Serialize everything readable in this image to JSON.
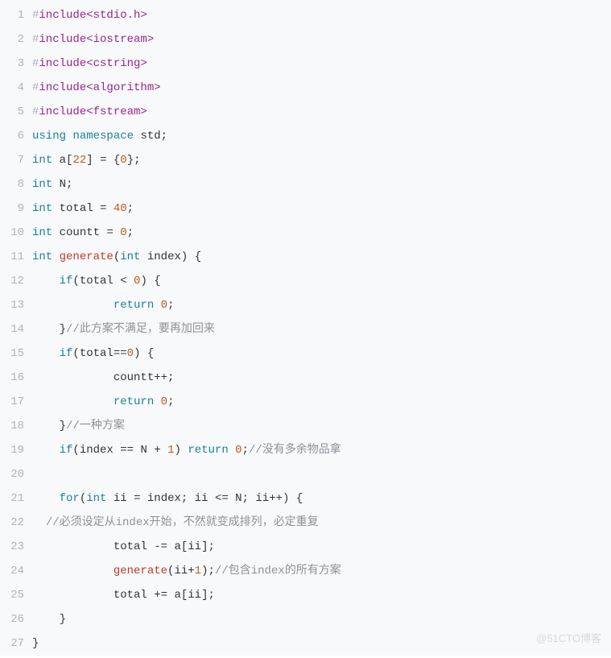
{
  "watermark": "@51CTO博客",
  "lines": [
    {
      "n": "1",
      "ind": 0,
      "tok": [
        [
          "pp",
          "#"
        ],
        [
          "kw",
          "include"
        ],
        [
          "hdr",
          "<stdio.h>"
        ]
      ]
    },
    {
      "n": "2",
      "ind": 0,
      "tok": [
        [
          "pp",
          "#"
        ],
        [
          "kw",
          "include"
        ],
        [
          "hdr",
          "<iostream>"
        ]
      ]
    },
    {
      "n": "3",
      "ind": 0,
      "tok": [
        [
          "pp",
          "#"
        ],
        [
          "kw",
          "include"
        ],
        [
          "hdr",
          "<cstring>"
        ]
      ]
    },
    {
      "n": "4",
      "ind": 0,
      "tok": [
        [
          "pp",
          "#"
        ],
        [
          "kw",
          "include"
        ],
        [
          "hdr",
          "<algorithm>"
        ]
      ]
    },
    {
      "n": "5",
      "ind": 0,
      "tok": [
        [
          "pp",
          "#"
        ],
        [
          "kw",
          "include"
        ],
        [
          "hdr",
          "<fstream>"
        ]
      ]
    },
    {
      "n": "6",
      "ind": 0,
      "tok": [
        [
          "kw2",
          "using"
        ],
        [
          "sp",
          " "
        ],
        [
          "kw2",
          "namespace"
        ],
        [
          "sp",
          " "
        ],
        [
          "id",
          "std"
        ],
        [
          "op",
          ";"
        ]
      ]
    },
    {
      "n": "7",
      "ind": 0,
      "tok": [
        [
          "kw2",
          "int"
        ],
        [
          "sp",
          " "
        ],
        [
          "id",
          "a"
        ],
        [
          "op",
          "["
        ],
        [
          "num",
          "22"
        ],
        [
          "op",
          "]"
        ],
        [
          "sp",
          " "
        ],
        [
          "op",
          "="
        ],
        [
          "sp",
          " "
        ],
        [
          "op",
          "{"
        ],
        [
          "num",
          "0"
        ],
        [
          "op",
          "};"
        ]
      ]
    },
    {
      "n": "8",
      "ind": 0,
      "tok": [
        [
          "kw2",
          "int"
        ],
        [
          "sp",
          " "
        ],
        [
          "id",
          "N"
        ],
        [
          "op",
          ";"
        ]
      ]
    },
    {
      "n": "9",
      "ind": 0,
      "tok": [
        [
          "kw2",
          "int"
        ],
        [
          "sp",
          " "
        ],
        [
          "id",
          "total"
        ],
        [
          "sp",
          " "
        ],
        [
          "op",
          "="
        ],
        [
          "sp",
          " "
        ],
        [
          "num",
          "40"
        ],
        [
          "op",
          ";"
        ]
      ]
    },
    {
      "n": "10",
      "ind": 0,
      "tok": [
        [
          "kw2",
          "int"
        ],
        [
          "sp",
          " "
        ],
        [
          "id",
          "countt"
        ],
        [
          "sp",
          " "
        ],
        [
          "op",
          "="
        ],
        [
          "sp",
          " "
        ],
        [
          "num",
          "0"
        ],
        [
          "op",
          ";"
        ]
      ]
    },
    {
      "n": "11",
      "ind": 0,
      "tok": [
        [
          "kw2",
          "int"
        ],
        [
          "sp",
          " "
        ],
        [
          "fn",
          "generate"
        ],
        [
          "op",
          "("
        ],
        [
          "kw2",
          "int"
        ],
        [
          "sp",
          " "
        ],
        [
          "id",
          "index"
        ],
        [
          "op",
          ")"
        ],
        [
          "sp",
          " "
        ],
        [
          "op",
          "{"
        ]
      ]
    },
    {
      "n": "12",
      "ind": 4,
      "tok": [
        [
          "kw2",
          "if"
        ],
        [
          "op",
          "("
        ],
        [
          "id",
          "total"
        ],
        [
          "sp",
          " "
        ],
        [
          "op",
          "<"
        ],
        [
          "sp",
          " "
        ],
        [
          "num",
          "0"
        ],
        [
          "op",
          ")"
        ],
        [
          "sp",
          " "
        ],
        [
          "op",
          "{"
        ]
      ]
    },
    {
      "n": "13",
      "ind": 12,
      "tok": [
        [
          "kw2",
          "return"
        ],
        [
          "sp",
          " "
        ],
        [
          "num",
          "0"
        ],
        [
          "op",
          ";"
        ]
      ]
    },
    {
      "n": "14",
      "ind": 4,
      "tok": [
        [
          "op",
          "}"
        ],
        [
          "cmt",
          "//此方案不满足，要再加回来"
        ]
      ]
    },
    {
      "n": "15",
      "ind": 4,
      "tok": [
        [
          "kw2",
          "if"
        ],
        [
          "op",
          "("
        ],
        [
          "id",
          "total"
        ],
        [
          "op",
          "=="
        ],
        [
          "num",
          "0"
        ],
        [
          "op",
          ")"
        ],
        [
          "sp",
          " "
        ],
        [
          "op",
          "{"
        ]
      ]
    },
    {
      "n": "16",
      "ind": 12,
      "tok": [
        [
          "id",
          "countt"
        ],
        [
          "op",
          "++;"
        ]
      ]
    },
    {
      "n": "17",
      "ind": 12,
      "tok": [
        [
          "kw2",
          "return"
        ],
        [
          "sp",
          " "
        ],
        [
          "num",
          "0"
        ],
        [
          "op",
          ";"
        ]
      ]
    },
    {
      "n": "18",
      "ind": 4,
      "tok": [
        [
          "op",
          "}"
        ],
        [
          "cmt",
          "//一种方案"
        ]
      ]
    },
    {
      "n": "19",
      "ind": 4,
      "tok": [
        [
          "kw2",
          "if"
        ],
        [
          "op",
          "("
        ],
        [
          "id",
          "index"
        ],
        [
          "sp",
          " "
        ],
        [
          "op",
          "=="
        ],
        [
          "sp",
          " "
        ],
        [
          "id",
          "N"
        ],
        [
          "sp",
          " "
        ],
        [
          "op",
          "+"
        ],
        [
          "sp",
          " "
        ],
        [
          "num",
          "1"
        ],
        [
          "op",
          ")"
        ],
        [
          "sp",
          " "
        ],
        [
          "kw2",
          "return"
        ],
        [
          "sp",
          " "
        ],
        [
          "num",
          "0"
        ],
        [
          "op",
          ";"
        ],
        [
          "cmt",
          "//没有多余物品拿"
        ]
      ]
    },
    {
      "n": "20",
      "ind": 0,
      "tok": []
    },
    {
      "n": "21",
      "ind": 4,
      "tok": [
        [
          "kw2",
          "for"
        ],
        [
          "op",
          "("
        ],
        [
          "kw2",
          "int"
        ],
        [
          "sp",
          " "
        ],
        [
          "id",
          "ii"
        ],
        [
          "sp",
          " "
        ],
        [
          "op",
          "="
        ],
        [
          "sp",
          " "
        ],
        [
          "id",
          "index"
        ],
        [
          "op",
          ";"
        ],
        [
          "sp",
          " "
        ],
        [
          "id",
          "ii"
        ],
        [
          "sp",
          " "
        ],
        [
          "op",
          "<="
        ],
        [
          "sp",
          " "
        ],
        [
          "id",
          "N"
        ],
        [
          "op",
          ";"
        ],
        [
          "sp",
          " "
        ],
        [
          "id",
          "ii"
        ],
        [
          "op",
          "++)"
        ],
        [
          "sp",
          " "
        ],
        [
          "op",
          "{"
        ]
      ]
    },
    {
      "n": "22",
      "ind": 2,
      "tok": [
        [
          "cmt",
          "//必须设定从index开始，不然就变成排列，必定重复"
        ]
      ]
    },
    {
      "n": "23",
      "ind": 12,
      "tok": [
        [
          "id",
          "total"
        ],
        [
          "sp",
          " "
        ],
        [
          "op",
          "-="
        ],
        [
          "sp",
          " "
        ],
        [
          "id",
          "a"
        ],
        [
          "op",
          "["
        ],
        [
          "id",
          "ii"
        ],
        [
          "op",
          "];"
        ]
      ]
    },
    {
      "n": "24",
      "ind": 12,
      "tok": [
        [
          "fn",
          "generate"
        ],
        [
          "op",
          "("
        ],
        [
          "id",
          "ii"
        ],
        [
          "op",
          "+"
        ],
        [
          "num",
          "1"
        ],
        [
          "op",
          ");"
        ],
        [
          "cmt",
          "//包含index的所有方案"
        ]
      ]
    },
    {
      "n": "25",
      "ind": 12,
      "tok": [
        [
          "id",
          "total"
        ],
        [
          "sp",
          " "
        ],
        [
          "op",
          "+="
        ],
        [
          "sp",
          " "
        ],
        [
          "id",
          "a"
        ],
        [
          "op",
          "["
        ],
        [
          "id",
          "ii"
        ],
        [
          "op",
          "];"
        ]
      ]
    },
    {
      "n": "26",
      "ind": 4,
      "tok": [
        [
          "op",
          "}"
        ]
      ]
    },
    {
      "n": "27",
      "ind": 0,
      "tok": [
        [
          "op",
          "}"
        ]
      ]
    }
  ]
}
